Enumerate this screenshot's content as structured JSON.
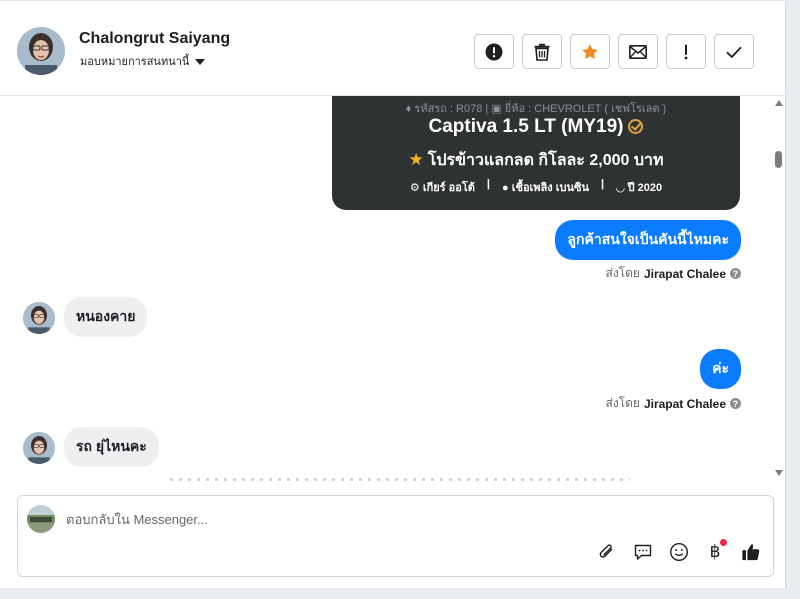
{
  "colors": {
    "accent": "#0a7cff",
    "star": "#f08a24",
    "card_bg": "#2f3233",
    "badge": "#e3a340",
    "notify": "#f02849"
  },
  "header": {
    "contact_name": "Chalongrut Saiyang",
    "assign_label": "มอบหมายการสนทนานี้",
    "actions": [
      {
        "name": "spam-button",
        "icon": "alert-circle-icon"
      },
      {
        "name": "delete-button",
        "icon": "trash-icon"
      },
      {
        "name": "star-button",
        "icon": "star-icon"
      },
      {
        "name": "mark-unread-button",
        "icon": "envelope-icon"
      },
      {
        "name": "follow-up-button",
        "icon": "exclamation-icon"
      },
      {
        "name": "done-button",
        "icon": "check-icon"
      }
    ]
  },
  "car_card": {
    "code_label": "รหัสรถ : R078",
    "brand_label": "ยี่ห้อ : CHEVROLET ( เชฟโรเลต )",
    "model": "Captiva 1.5 LT (MY19)",
    "promo": "โปรข้าวแลกลด กิโลละ 2,000 บาท",
    "gear": "เกียร์ ออโต้",
    "fuel": "เชื้อเพลิง เบนซิน",
    "year": "ปี 2020"
  },
  "messages": [
    {
      "dir": "out",
      "text": "ลูกค้าสนใจเป็นคันนี้ไหมคะ",
      "sent_by_prefix": "ส่งโดย",
      "sent_by_name": "Jirapat Chalee"
    },
    {
      "dir": "in",
      "text": "หนองคาย"
    },
    {
      "dir": "out",
      "text": "ค่ะ",
      "sent_by_prefix": "ส่งโดย",
      "sent_by_name": "Jirapat Chalee"
    },
    {
      "dir": "in",
      "text": "รถ ยุ่ไหนคะ"
    }
  ],
  "composer": {
    "placeholder": "ตอบกลับใน Messenger...",
    "tools": [
      "paperclip-icon",
      "comment-icon",
      "smiley-icon",
      "baht-icon",
      "thumbs-up-icon"
    ]
  }
}
